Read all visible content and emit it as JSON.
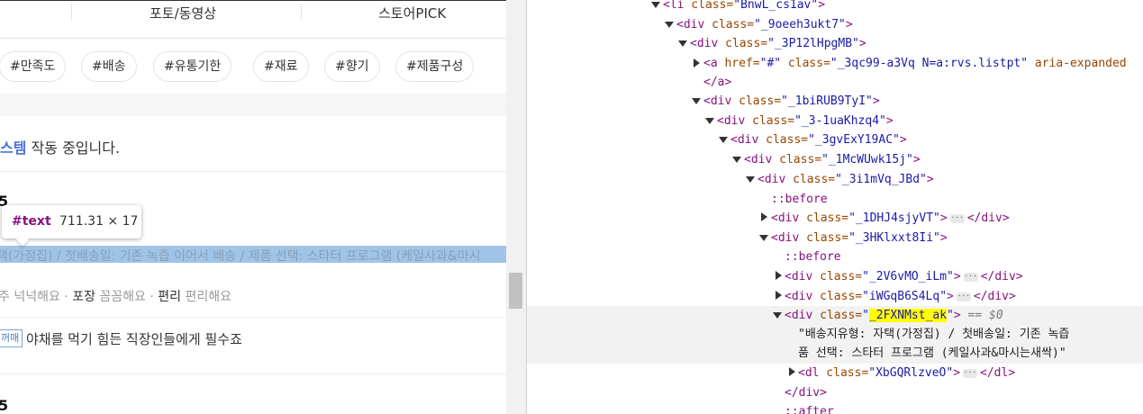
{
  "left": {
    "tabs": [
      "포토/동영상",
      "스토어PICK"
    ],
    "chips": [
      "#만족도",
      "#배송",
      "#유통기한",
      "#재료",
      "#향기",
      "#제품구성"
    ],
    "notice": {
      "highlight": "스템",
      "rest": " 작동 중입니다."
    },
    "score_top": "5",
    "tooltip": {
      "name": "#text",
      "size": "711.31 × 17"
    },
    "highlight_row": "택(가정집) / 첫배송일: 기존 녹즙 이어서 배송 / 제품 선택: 스타터 프로그램 (케일사과&마시",
    "tags": {
      "p1": "주 넉넉해요 · ",
      "b1": "포장",
      "p2": " 꼼꼼해요 · ",
      "b2": "편리",
      "p3": " 편리해요"
    },
    "badge": "꺼매",
    "review": "야채를 먹기 힘든 직장인들에게 필수죠",
    "score_bottom": "5"
  },
  "devtools": {
    "l1": {
      "tag": "<li",
      "attr": " class=",
      "val": "\"BnwL_cs1av\"",
      "close": ">"
    },
    "l2": {
      "tag": "<div",
      "attr": " class=",
      "val": "\"_9oeeh3ukt7\"",
      "close": ">"
    },
    "l3": {
      "tag": "<div",
      "attr": " class=",
      "val": "\"_3P12lHpgMB\"",
      "close": ">"
    },
    "l4": {
      "tag": "<a",
      "a1": " href=",
      "v1": "\"#\"",
      "a2": " class=",
      "v2": "\"_3qc99-a3Vq N=a:rvs.listpt\"",
      "a3": " aria-expanded",
      "close": ""
    },
    "l5": {
      "tag": "</a>"
    },
    "l6": {
      "tag": "<div",
      "attr": " class=",
      "val": "\"_1biRUB9TyI\"",
      "close": ">"
    },
    "l7": {
      "tag": "<div",
      "attr": " class=",
      "val": "\"_3-1uaKhzq4\"",
      "close": ">"
    },
    "l8": {
      "tag": "<div",
      "attr": " class=",
      "val": "\"_3gvExY19AC\"",
      "close": ">"
    },
    "l9": {
      "tag": "<div",
      "attr": " class=",
      "val": "\"_1McWUwk15j\"",
      "close": ">"
    },
    "l10": {
      "tag": "<div",
      "attr": " class=",
      "val": "\"_3i1mVq_JBd\"",
      "close": ">"
    },
    "l11": {
      "pseudo": "::before"
    },
    "l12": {
      "tag": "<div",
      "attr": " class=",
      "val": "\"_1DHJ4sjyVT\"",
      "close": ">",
      "end": "</div>"
    },
    "l13": {
      "tag": "<div",
      "attr": " class=",
      "val": "\"_3HKlxxt8Ii\"",
      "close": ">"
    },
    "l14": {
      "pseudo": "::before"
    },
    "l15": {
      "tag": "<div",
      "attr": " class=",
      "val": "\"_2V6vMO_iLm\"",
      "close": ">",
      "end": "</div>"
    },
    "l16": {
      "tag": "<div",
      "attr": " class=",
      "val": "\"iWGqB6S4Lq\"",
      "close": ">",
      "end": "</div>"
    },
    "l17": {
      "tag": "<div",
      "attr": " class=",
      "q1": "\"",
      "valhl": "_2FXNMst_ak",
      "q2": "\"",
      "close": ">",
      "eq": " == $0"
    },
    "l18": {
      "text": "\"배송지유형: 자택(가정집) / 첫배송일: 기존 녹즙"
    },
    "l19": {
      "text": "품 선택: 스타터 프로그램 (케일사과&마시는새싹)\""
    },
    "l20": {
      "tag": "<dl",
      "attr": " class=",
      "val": "\"XbGQRlzveO\"",
      "close": ">",
      "end": "</dl>"
    },
    "l21": {
      "tag": "</div>"
    },
    "l22": {
      "pseudo": "::after"
    },
    "ellipsis": "···"
  }
}
